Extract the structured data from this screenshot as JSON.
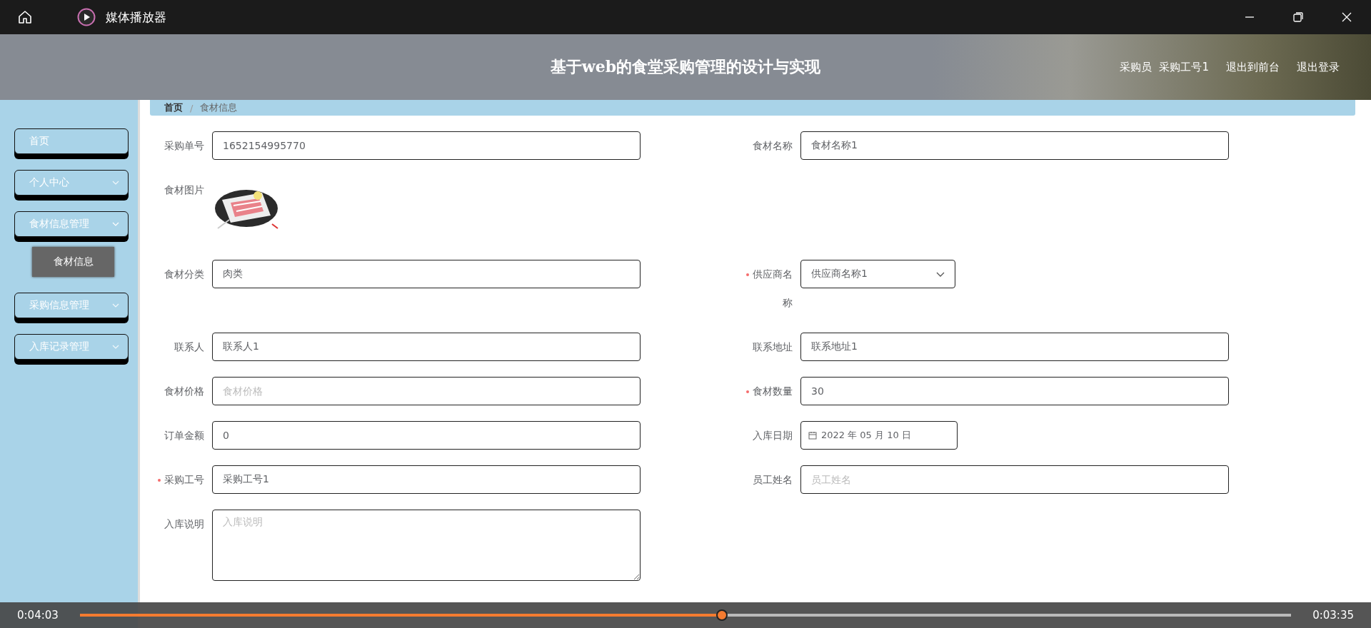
{
  "window": {
    "title": "媒体播放器"
  },
  "header": {
    "title": "基于web的食堂采购管理的设计与实现",
    "role": "采购员",
    "user": "采购工号1",
    "links": [
      "退出到前台",
      "退出登录"
    ]
  },
  "sidebar": {
    "items": [
      {
        "label": "首页"
      },
      {
        "label": "个人中心",
        "expanded": false
      },
      {
        "label": "食材信息管理",
        "expanded": true,
        "children": [
          {
            "label": "食材信息",
            "selected": true
          }
        ]
      },
      {
        "label": "采购信息管理",
        "expanded": false
      },
      {
        "label": "入库记录管理",
        "expanded": false
      }
    ]
  },
  "breadcrumb": {
    "items": [
      "首页",
      "食材信息"
    ],
    "separator": "/"
  },
  "form": {
    "rows": [
      [
        {
          "kind": "input",
          "label": "采购单号",
          "required": false,
          "value": "1652154995770"
        },
        {
          "kind": "input",
          "label": "食材名称",
          "required": false,
          "value": "食材名称1"
        }
      ],
      [
        {
          "kind": "image",
          "label": "食材图片",
          "required": false
        }
      ],
      [
        {
          "kind": "input",
          "label": "食材分类",
          "required": false,
          "value": "肉类"
        },
        {
          "kind": "select",
          "label": "供应商名称",
          "required": true,
          "value": "供应商名称1"
        }
      ],
      [
        {
          "kind": "input",
          "label": "联系人",
          "required": false,
          "value": "联系人1"
        },
        {
          "kind": "input",
          "label": "联系地址",
          "required": false,
          "value": "联系地址1"
        }
      ],
      [
        {
          "kind": "input",
          "label": "食材价格",
          "required": false,
          "placeholder": "食材价格"
        },
        {
          "kind": "input",
          "label": "食材数量",
          "required": true,
          "value": "30"
        }
      ],
      [
        {
          "kind": "input",
          "label": "订单金额",
          "required": false,
          "value": "0"
        },
        {
          "kind": "date",
          "label": "入库日期",
          "required": false,
          "value": "2022 年 05 月 10 日"
        }
      ],
      [
        {
          "kind": "input",
          "label": "采购工号",
          "required": true,
          "value": "采购工号1"
        },
        {
          "kind": "input",
          "label": "员工姓名",
          "required": false,
          "placeholder": "员工姓名"
        }
      ],
      [
        {
          "kind": "textarea",
          "label": "入库说明",
          "required": false,
          "placeholder": "入库说明"
        }
      ]
    ]
  },
  "player": {
    "elapsed": "0:04:03",
    "remaining": "0:03:35",
    "level": 0.53
  }
}
